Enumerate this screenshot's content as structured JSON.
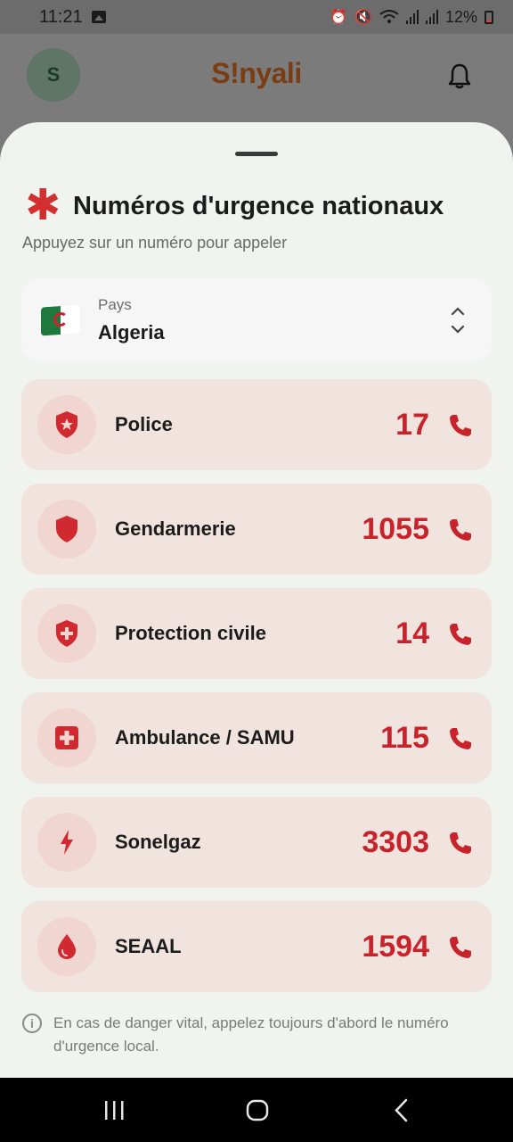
{
  "status_bar": {
    "time": "11:21",
    "battery": "12%",
    "icons": [
      "gallery-icon",
      "alarm-icon",
      "mute-icon",
      "wifi-icon",
      "signal-icon",
      "signal-icon",
      "battery-icon"
    ]
  },
  "app_header": {
    "avatar_initial": "S",
    "title": "S!nyali",
    "bell_icon": "bell-icon"
  },
  "sheet": {
    "title": "Numéros d'urgence nationaux",
    "subtitle": "Appuyez sur un numéro pour appeler",
    "country": {
      "label": "Pays",
      "value": "Algeria",
      "flag_icon": "algeria-flag-icon"
    },
    "services": [
      {
        "label": "Police",
        "number": "17",
        "icon": "police-badge-icon"
      },
      {
        "label": "Gendarmerie",
        "number": "1055",
        "icon": "shield-icon"
      },
      {
        "label": "Protection civile",
        "number": "14",
        "icon": "shield-cross-icon"
      },
      {
        "label": "Ambulance / SAMU",
        "number": "115",
        "icon": "medical-cross-icon"
      },
      {
        "label": "Sonelgaz",
        "number": "3303",
        "icon": "lightning-icon"
      },
      {
        "label": "SEAAL",
        "number": "1594",
        "icon": "water-drop-icon"
      }
    ],
    "info": "En cas de danger vital, appelez toujours d'abord le numéro d'urgence local."
  },
  "colors": {
    "accent": "#c8232b",
    "row_bg": "#f1e4df",
    "sheet_bg": "#f1f3ee"
  }
}
